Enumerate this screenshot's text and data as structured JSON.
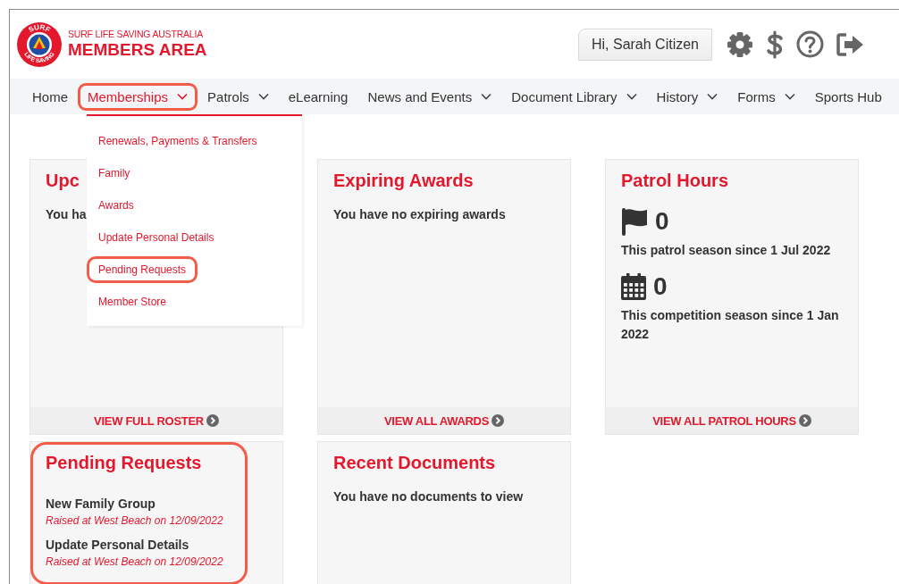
{
  "logo": {
    "ring_top": "SURF",
    "ring_bottom": "LIFE SAVING",
    "organisation": "SURF LIFE SAVING AUSTRALIA",
    "title": "MEMBERS AREA"
  },
  "user": {
    "greeting": "Hi, Sarah Citizen"
  },
  "nav": [
    {
      "label": "Home",
      "has_menu": false,
      "selected": false,
      "highlighted": false
    },
    {
      "label": "Memberships",
      "has_menu": true,
      "selected": true,
      "highlighted": true
    },
    {
      "label": "Patrols",
      "has_menu": true,
      "selected": false,
      "highlighted": false
    },
    {
      "label": "eLearning",
      "has_menu": false,
      "selected": false,
      "highlighted": false
    },
    {
      "label": "News and Events",
      "has_menu": true,
      "selected": false,
      "highlighted": false
    },
    {
      "label": "Document Library",
      "has_menu": true,
      "selected": false,
      "highlighted": false
    },
    {
      "label": "History",
      "has_menu": true,
      "selected": false,
      "highlighted": false
    },
    {
      "label": "Forms",
      "has_menu": true,
      "selected": false,
      "highlighted": false
    },
    {
      "label": "Sports Hub",
      "has_menu": false,
      "selected": false,
      "highlighted": false
    }
  ],
  "dropdown": {
    "items": [
      {
        "label": "Renewals, Payments & Transfers",
        "highlighted": false
      },
      {
        "label": "Family",
        "highlighted": false
      },
      {
        "label": "Awards",
        "highlighted": false
      },
      {
        "label": "Update Personal Details",
        "highlighted": false
      },
      {
        "label": "Pending Requests",
        "highlighted": true
      },
      {
        "label": "Member Store",
        "highlighted": false
      }
    ]
  },
  "cards": [
    {
      "kind": "message",
      "title": "Upc",
      "message": "You ha",
      "footer_link": "VIEW FULL ROSTER",
      "highlighted": false
    },
    {
      "kind": "message",
      "title": "Expiring Awards",
      "message": "You have no expiring awards",
      "footer_link": "VIEW ALL AWARDS",
      "highlighted": false
    },
    {
      "kind": "stats",
      "title": "Patrol Hours",
      "stats": [
        {
          "value": "0",
          "caption": "This patrol season since 1 Jul 2022"
        },
        {
          "value": "0",
          "caption": "This competition season since 1 Jan 2022"
        }
      ],
      "footer_link": "VIEW ALL PATROL HOURS",
      "highlighted": false
    },
    {
      "kind": "requests",
      "title": "Pending Requests",
      "requests": [
        {
          "name": "New Family Group",
          "detail": "Raised at West Beach on 12/09/2022"
        },
        {
          "name": "Update Personal Details",
          "detail": "Raised at West Beach on 12/09/2022"
        }
      ],
      "highlighted": true
    },
    {
      "kind": "message",
      "title": "Recent Documents",
      "message": "You have no documents to view",
      "highlighted": false
    }
  ]
}
